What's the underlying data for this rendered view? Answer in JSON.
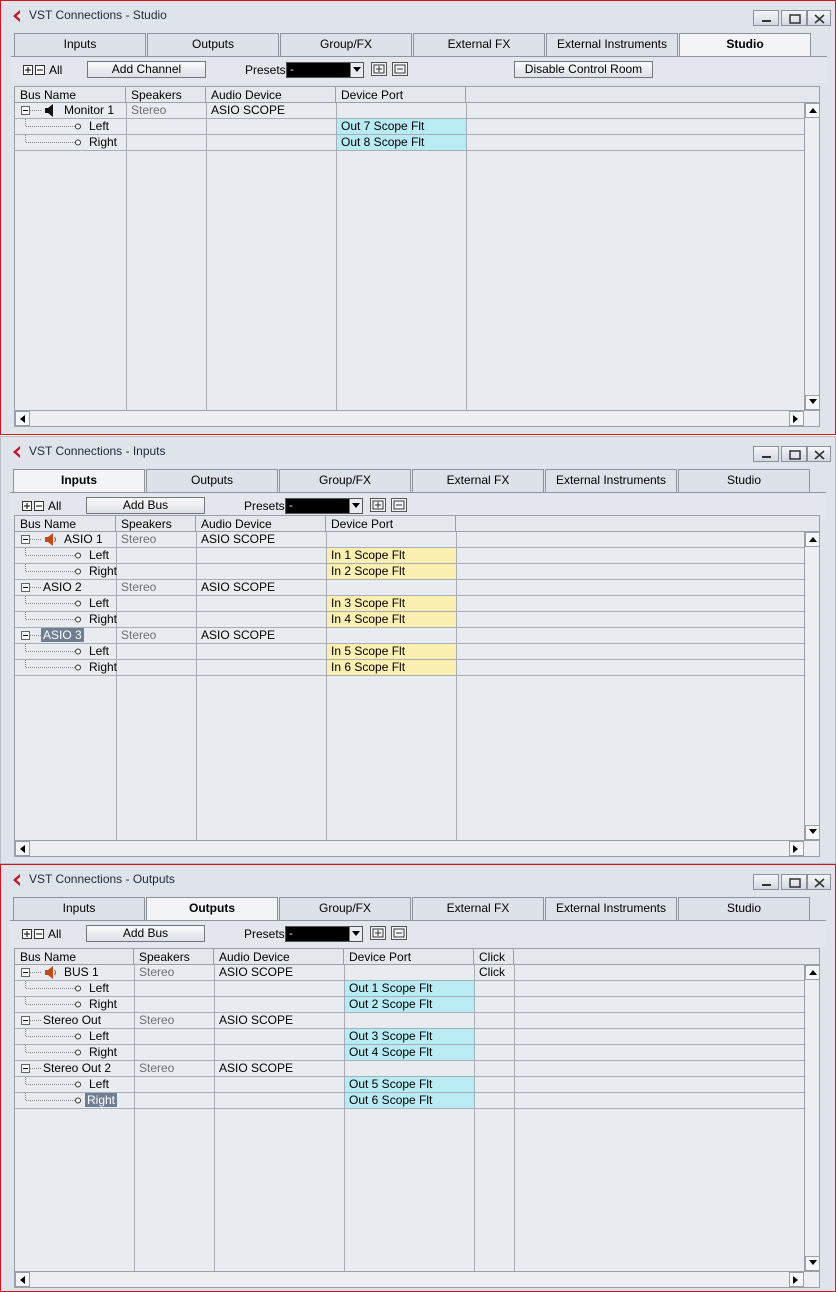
{
  "app": {
    "brand_color": "#c8102e"
  },
  "tabs": [
    "Inputs",
    "Outputs",
    "Group/FX",
    "External FX",
    "External Instruments",
    "Studio"
  ],
  "toolbar": {
    "all_label": "All",
    "presets_label": "Presets",
    "preset_value": "-"
  },
  "windows": [
    {
      "title": "VST Connections - Studio",
      "add_label": "Add Channel",
      "extra_button": "Disable Control Room",
      "columns": [
        "Bus Name",
        "Speakers",
        "Audio Device",
        "Device Port"
      ],
      "rows": [
        {
          "name": "Monitor 1",
          "speakers": "Stereo",
          "device": "ASIO SCOPE",
          "port": ""
        },
        {
          "name": "Left",
          "speakers": "",
          "device": "",
          "port": "Out 7 Scope Flt"
        },
        {
          "name": "Right",
          "speakers": "",
          "device": "",
          "port": "Out 8 Scope Flt"
        }
      ]
    },
    {
      "title": "VST Connections - Inputs",
      "add_label": "Add Bus",
      "columns": [
        "Bus Name",
        "Speakers",
        "Audio Device",
        "Device Port"
      ],
      "rows": [
        {
          "name": "ASIO 1",
          "speakers": "Stereo",
          "device": "ASIO SCOPE",
          "port": ""
        },
        {
          "name": "Left",
          "speakers": "",
          "device": "",
          "port": "In 1 Scope Flt"
        },
        {
          "name": "Right",
          "speakers": "",
          "device": "",
          "port": "In 2 Scope Flt"
        },
        {
          "name": "ASIO 2",
          "speakers": "Stereo",
          "device": "ASIO SCOPE",
          "port": ""
        },
        {
          "name": "Left",
          "speakers": "",
          "device": "",
          "port": "In 3 Scope Flt"
        },
        {
          "name": "Right",
          "speakers": "",
          "device": "",
          "port": "In 4 Scope Flt"
        },
        {
          "name": "ASIO 3",
          "speakers": "Stereo",
          "device": "ASIO SCOPE",
          "port": ""
        },
        {
          "name": "Left",
          "speakers": "",
          "device": "",
          "port": "In 5 Scope Flt"
        },
        {
          "name": "Right",
          "speakers": "",
          "device": "",
          "port": "In 6 Scope Flt"
        }
      ]
    },
    {
      "title": "VST Connections - Outputs",
      "add_label": "Add Bus",
      "columns": [
        "Bus Name",
        "Speakers",
        "Audio Device",
        "Device Port",
        "Click"
      ],
      "rows": [
        {
          "name": "BUS 1",
          "speakers": "Stereo",
          "device": "ASIO SCOPE",
          "port": "",
          "click": "Click"
        },
        {
          "name": "Left",
          "speakers": "",
          "device": "",
          "port": "Out 1 Scope Flt",
          "click": ""
        },
        {
          "name": "Right",
          "speakers": "",
          "device": "",
          "port": "Out 2 Scope Flt",
          "click": ""
        },
        {
          "name": "Stereo Out",
          "speakers": "Stereo",
          "device": "ASIO SCOPE",
          "port": "",
          "click": ""
        },
        {
          "name": "Left",
          "speakers": "",
          "device": "",
          "port": "Out 3 Scope Flt",
          "click": ""
        },
        {
          "name": "Right",
          "speakers": "",
          "device": "",
          "port": "Out 4 Scope Flt",
          "click": ""
        },
        {
          "name": "Stereo Out 2",
          "speakers": "Stereo",
          "device": "ASIO SCOPE",
          "port": "",
          "click": ""
        },
        {
          "name": "Left",
          "speakers": "",
          "device": "",
          "port": "Out 5 Scope Flt",
          "click": ""
        },
        {
          "name": "Right",
          "speakers": "",
          "device": "",
          "port": "Out 6 Scope Flt",
          "click": ""
        }
      ]
    }
  ]
}
